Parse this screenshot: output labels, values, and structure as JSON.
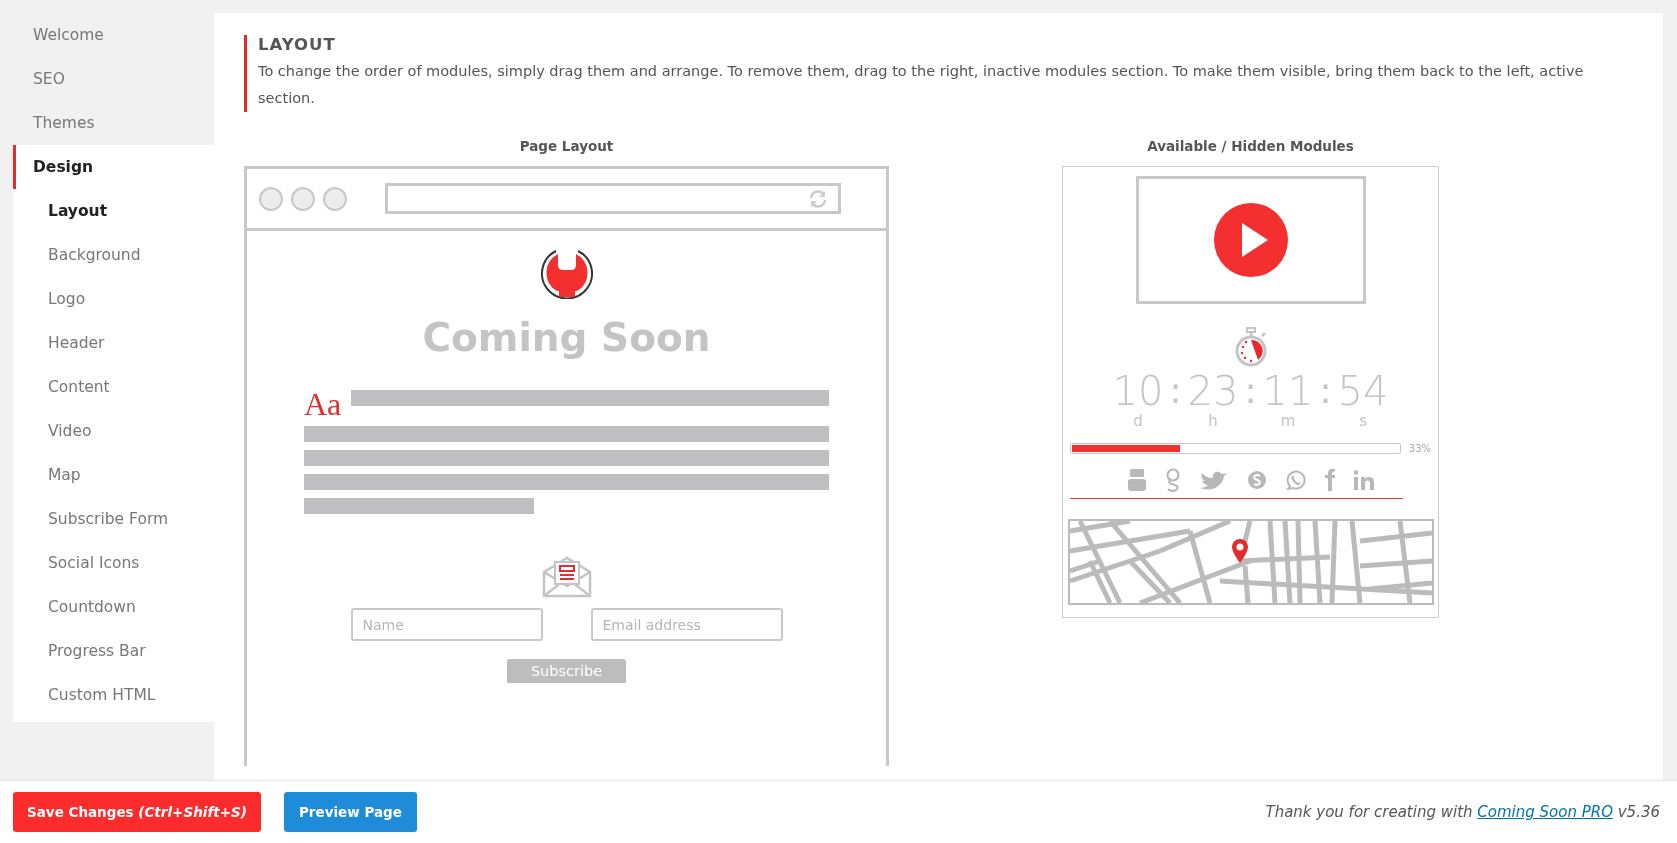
{
  "sidebar": {
    "items": [
      {
        "label": "Welcome",
        "selected": false
      },
      {
        "label": "SEO",
        "selected": false
      },
      {
        "label": "Themes",
        "selected": false
      },
      {
        "label": "Design",
        "selected": true,
        "children": [
          {
            "label": "Layout",
            "selected": true
          },
          {
            "label": "Background",
            "selected": false
          },
          {
            "label": "Logo",
            "selected": false
          },
          {
            "label": "Header",
            "selected": false
          },
          {
            "label": "Content",
            "selected": false
          },
          {
            "label": "Video",
            "selected": false
          },
          {
            "label": "Map",
            "selected": false
          },
          {
            "label": "Subscribe Form",
            "selected": false
          },
          {
            "label": "Social Icons",
            "selected": false
          },
          {
            "label": "Countdown",
            "selected": false
          },
          {
            "label": "Progress Bar",
            "selected": false
          },
          {
            "label": "Custom HTML",
            "selected": false
          }
        ]
      }
    ]
  },
  "section": {
    "title": "LAYOUT",
    "description": "To change the order of modules, simply drag them and arrange. To remove them, drag to the right, inactive modules section. To make them visible, bring them back to the left, active section."
  },
  "page_layout": {
    "title": "Page Layout",
    "heading": "Coming Soon",
    "font_sample": "Aa",
    "name_placeholder": "Name",
    "email_placeholder": "Email address",
    "subscribe_label": "Subscribe"
  },
  "modules": {
    "title": "Available / Hidden Modules",
    "countdown": {
      "values": [
        {
          "value": "10",
          "unit": "d"
        },
        {
          "value": "23",
          "unit": "h"
        },
        {
          "value": "11",
          "unit": "m"
        },
        {
          "value": "54",
          "unit": "s"
        }
      ],
      "separators": [
        ":",
        ":",
        ":"
      ]
    },
    "progress": {
      "level": 0.33,
      "reading": "33%"
    }
  },
  "footer": {
    "save_button": "Save Changes *(Ctrl+Shift+S)*",
    "preview_button": "Preview Page",
    "credit_text": "Thank you for creating with",
    "credit_link": "Coming Soon PRO",
    "version": "v5.36"
  }
}
